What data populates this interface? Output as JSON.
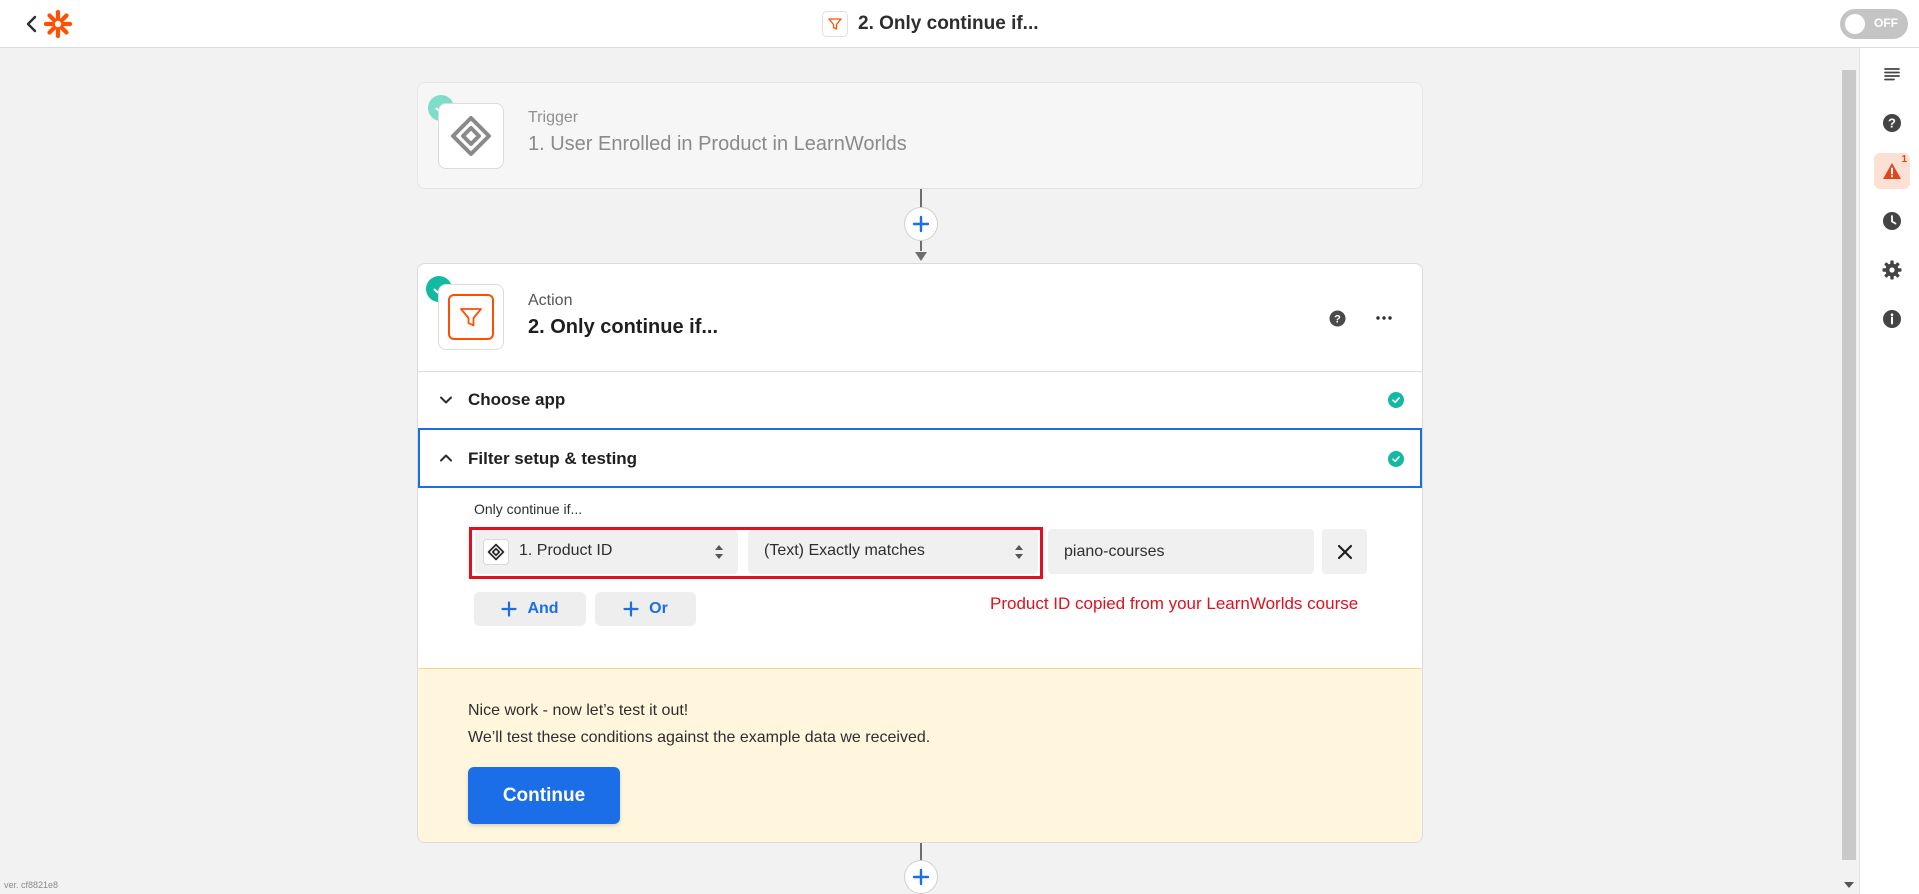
{
  "header": {
    "title": "2. Only continue if...",
    "toggle_label": "OFF"
  },
  "trigger": {
    "label": "Trigger",
    "title": "1. User Enrolled in Product in LearnWorlds"
  },
  "action": {
    "label": "Action",
    "title": "2. Only continue if..."
  },
  "sections": {
    "choose_app": "Choose app",
    "filter_setup": "Filter setup & testing"
  },
  "filter": {
    "label": "Only continue if...",
    "field": "1. Product ID",
    "condition": "(Text) Exactly matches",
    "value": "piano-courses",
    "and_label": "And",
    "or_label": "Or",
    "note": "Product ID copied from your LearnWorlds course"
  },
  "test": {
    "line1": "Nice work - now let’s test it out!",
    "line2": "We’ll test these conditions against the example data we received.",
    "continue_label": "Continue"
  },
  "sidebar": {
    "alert_count": "1",
    "icons": [
      "outline-icon",
      "help-icon",
      "alert-icon",
      "history-icon",
      "settings-icon",
      "info-icon"
    ]
  },
  "version": "ver. cf8821e8",
  "colors": {
    "accent": "#1b6ee8",
    "brand": "#ff4f00",
    "success": "#13b9a3",
    "highlight": "#e0101e",
    "test_bg": "#fff6dd"
  }
}
